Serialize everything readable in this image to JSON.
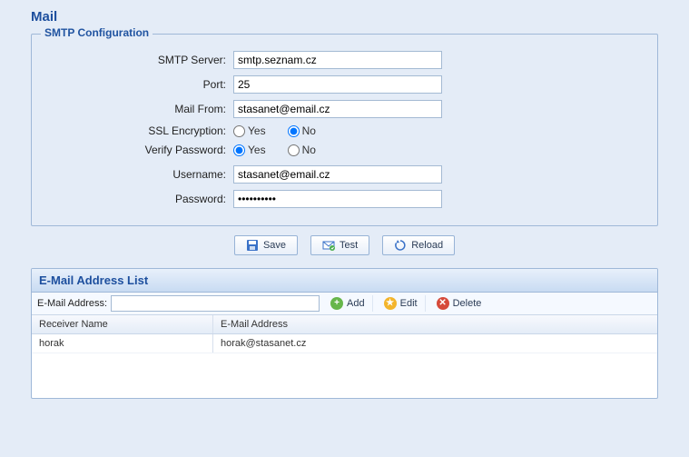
{
  "pageTitle": "Mail",
  "fieldset": {
    "legend": "SMTP Configuration",
    "smtpServer": {
      "label": "SMTP Server:",
      "value": "smtp.seznam.cz"
    },
    "port": {
      "label": "Port:",
      "value": "25"
    },
    "mailFrom": {
      "label": "Mail From:",
      "value": "stasanet@email.cz"
    },
    "ssl": {
      "label": "SSL Encryption:",
      "yes": "Yes",
      "no": "No",
      "selected": "no"
    },
    "verify": {
      "label": "Verify Password:",
      "yes": "Yes",
      "no": "No",
      "selected": "yes"
    },
    "username": {
      "label": "Username:",
      "value": "stasanet@email.cz"
    },
    "password": {
      "label": "Password:",
      "value": "••••••••••"
    }
  },
  "buttons": {
    "save": "Save",
    "test": "Test",
    "reload": "Reload"
  },
  "listPanel": {
    "title": "E-Mail Address List",
    "toolbar": {
      "label": "E-Mail Address:",
      "value": "",
      "add": "Add",
      "edit": "Edit",
      "delete": "Delete"
    },
    "columns": {
      "receiver": "Receiver Name",
      "email": "E-Mail Address"
    },
    "rows": [
      {
        "name": "horak",
        "email": "horak@stasanet.cz"
      }
    ]
  }
}
